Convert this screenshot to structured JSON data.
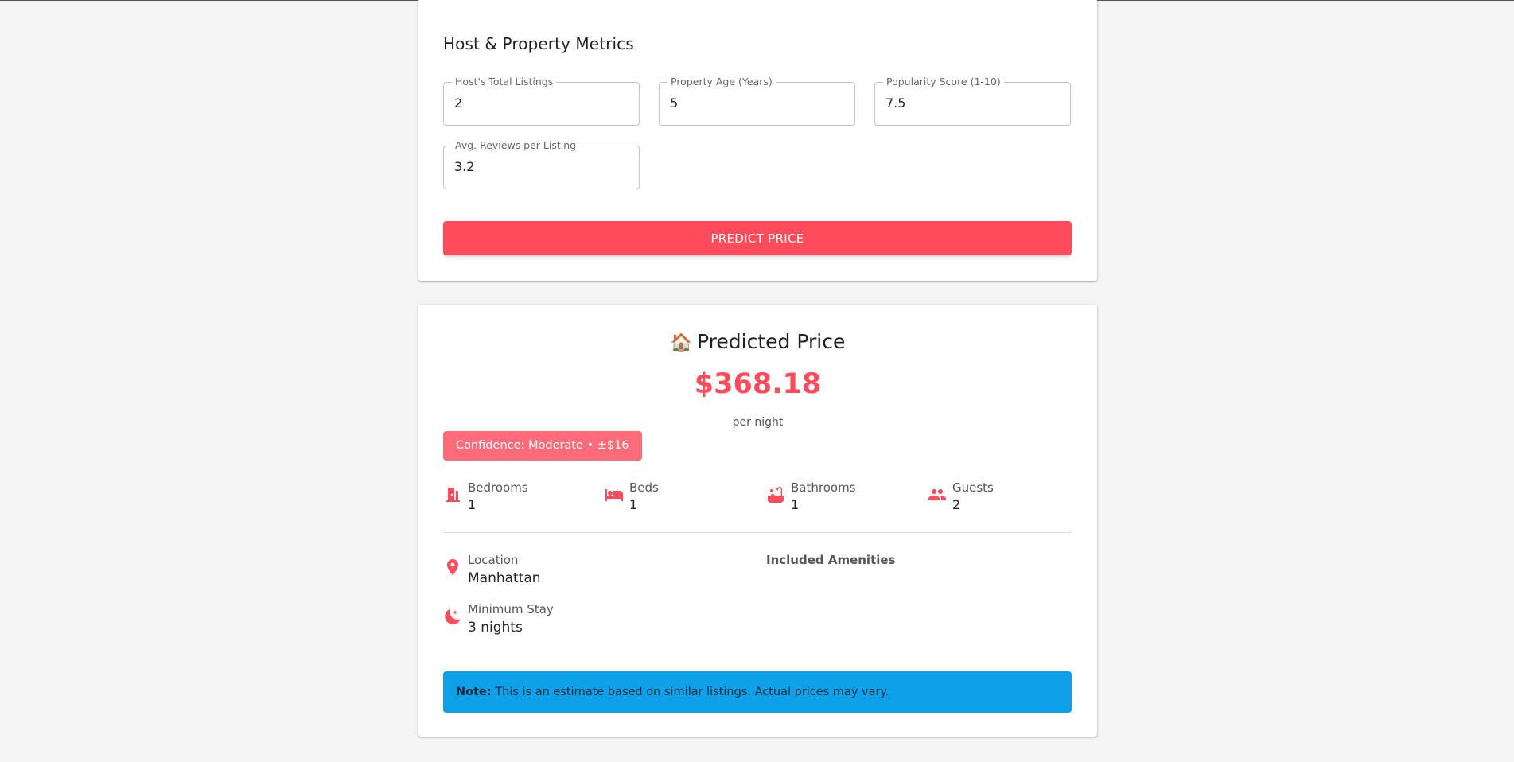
{
  "metrics_section": {
    "title": "Host & Property Metrics",
    "fields": [
      {
        "label": "Host's Total Listings",
        "value": "2"
      },
      {
        "label": "Property Age (Years)",
        "value": "5"
      },
      {
        "label": "Popularity Score (1-10)",
        "value": "7.5"
      },
      {
        "label": "Avg. Reviews per Listing",
        "value": "3.2"
      }
    ],
    "predict_button": "PREDICT PRICE"
  },
  "result": {
    "title_emoji": "🏠",
    "title": "Predicted Price",
    "price": "$368.18",
    "unit": "per night",
    "confidence": "Confidence: Moderate • ±$16",
    "stats": [
      {
        "icon": "door-icon",
        "label": "Bedrooms",
        "value": "1"
      },
      {
        "icon": "bed-icon",
        "label": "Beds",
        "value": "1"
      },
      {
        "icon": "bathtub-icon",
        "label": "Bathrooms",
        "value": "1"
      },
      {
        "icon": "people-icon",
        "label": "Guests",
        "value": "2"
      }
    ],
    "location": {
      "icon": "location-pin-icon",
      "label": "Location",
      "value": "Manhattan"
    },
    "minimum_stay": {
      "icon": "moon-icon",
      "label": "Minimum Stay",
      "value": "3 nights"
    },
    "amenities_label": "Included Amenities",
    "note": {
      "bold": "Note:",
      "text": " This is an estimate based on similar listings. Actual prices may vary."
    }
  },
  "colors": {
    "accent": "#ff4b5a",
    "confidence_bg": "#ff6b78",
    "info_bg": "#0ea1e9"
  }
}
